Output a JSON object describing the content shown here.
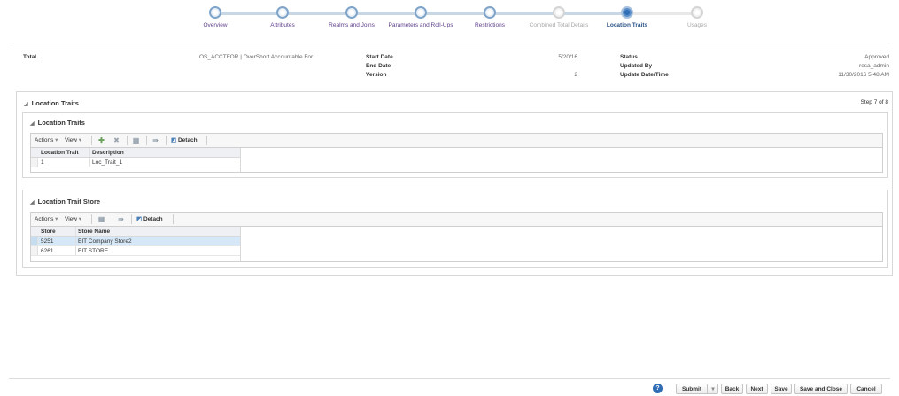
{
  "train": {
    "steps": [
      {
        "label": "Overview",
        "state": "visited"
      },
      {
        "label": "Attributes",
        "state": "visited"
      },
      {
        "label": "Realms and Joins",
        "state": "visited"
      },
      {
        "label": "Parameters and Roll-Ups",
        "state": "visited"
      },
      {
        "label": "Restrictions",
        "state": "visited"
      },
      {
        "label": "Combined Total Details",
        "state": "disabled"
      },
      {
        "label": "Location Traits",
        "state": "current"
      },
      {
        "label": "Usages",
        "state": "disabled"
      }
    ]
  },
  "summary": {
    "name": "Total",
    "code": "OS_ACCTFOR | OverShort Accountable For",
    "start_date_label": "Start Date",
    "start_date_value": "5/20/16",
    "end_date_label": "End Date",
    "version_label": "Version",
    "version_value": "2",
    "status_label": "Status",
    "status_value": "Approved",
    "updated_by_label": "Updated By",
    "updated_by_value": "resa_admin",
    "update_datetime_label": "Update Date/Time",
    "update_datetime_value": "11/30/2016 5:48 AM"
  },
  "main_panel": {
    "title": "Location Traits",
    "step_text": "Step 7 of 8"
  },
  "traits_panel": {
    "title": "Location Traits",
    "toolbar": {
      "actions": "Actions",
      "view": "View",
      "detach": "Detach"
    },
    "columns": [
      "Location Trait",
      "Description"
    ],
    "rows": [
      [
        "1",
        "Loc_Trait_1"
      ]
    ]
  },
  "store_panel": {
    "title": "Location Trait Store",
    "toolbar": {
      "actions": "Actions",
      "view": "View",
      "detach": "Detach"
    },
    "columns": [
      "Store",
      "Store Name"
    ],
    "rows": [
      [
        "5251",
        "EIT Company Store2"
      ],
      [
        "6261",
        "EIT STORE"
      ]
    ]
  },
  "footer": {
    "help": "?",
    "submit": "Submit",
    "back": "Back",
    "next": "Next",
    "save": "Save",
    "save_close": "Save and Close",
    "cancel": "Cancel"
  },
  "colors": {
    "accent": "#2f6db5",
    "visited_label": "#5c3d8a",
    "selected_row": "#d6e8f7"
  }
}
